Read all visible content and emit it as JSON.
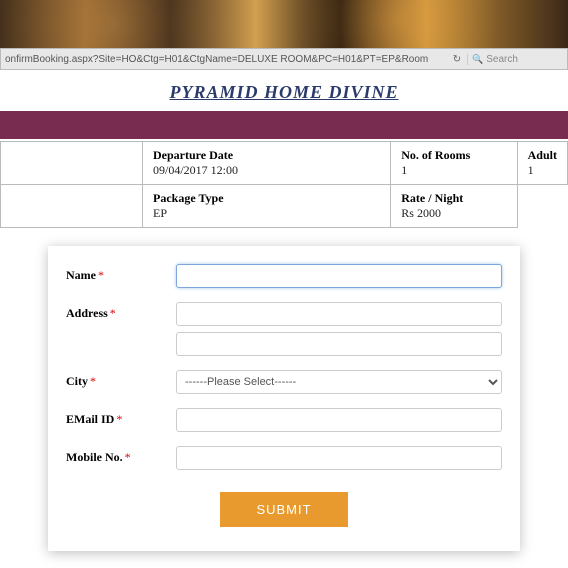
{
  "browser": {
    "url": "onfirmBooking.aspx?Site=HO&Ctg=H01&CtgName=DELUXE ROOM&PC=H01&PT=EP&Room",
    "search_placeholder": "Search"
  },
  "site": {
    "title": "PYRAMID HOME DIVINE"
  },
  "booking": {
    "departure_label": "Departure Date",
    "departure_value": "09/04/2017 12:00",
    "rooms_label": "No. of Rooms",
    "rooms_value": "1",
    "adult_label": "Adult",
    "adult_value": "1",
    "package_label": "Package Type",
    "package_value": "EP",
    "rate_label": "Rate / Night",
    "rate_value": "Rs 2000"
  },
  "form": {
    "name_label": "Name",
    "address_label": "Address",
    "city_label": "City",
    "city_placeholder": "------Please Select------",
    "email_label": "EMail ID",
    "mobile_label": "Mobile No.",
    "submit_label": "SUBMIT",
    "asterisk": "*"
  }
}
